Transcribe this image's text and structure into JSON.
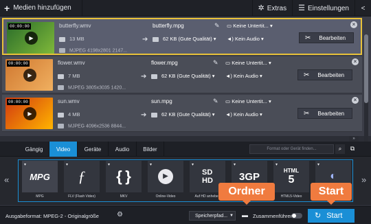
{
  "toolbar": {
    "add_media_label": "Medien hinzufügen",
    "extras_label": "Extras",
    "settings_label": "Einstellungen"
  },
  "files": [
    {
      "timecode": "00:00:00",
      "source_name": "butterfly.wmv",
      "source_size": "13 MB",
      "source_info": "MJPEG 4198x2801 2147...",
      "output_name": "butterfly.mpg",
      "output_size": "62 KB (Gute Qualität)",
      "subtitles": "Keine Untertit...",
      "audio": "Kein Audio",
      "edit_label": "Bearbeiten",
      "selected": true,
      "thumb_colors": [
        "#2a6d2a",
        "#7fb83a"
      ]
    },
    {
      "timecode": "00:00:00",
      "source_name": "flower.wmv",
      "source_size": "7 MB",
      "source_info": "MJPEG 3805x3035 1420...",
      "output_name": "flower.mpg",
      "output_size": "62 KB (Gute Qualität)",
      "subtitles": "Keine Untertit...",
      "audio": "Kein Audio",
      "edit_label": "Bearbeiten",
      "selected": false,
      "thumb_colors": [
        "#d07830",
        "#f0b060"
      ]
    },
    {
      "timecode": "00:00:00",
      "source_name": "sun.wmv",
      "source_size": "4 MB",
      "source_info": "MJPEG 4096x2536 8844...",
      "output_name": "sun.mpg",
      "output_size": "62 KB (Gute Qualität)",
      "subtitles": "Keine Untertit...",
      "audio": "Kein Audio",
      "edit_label": "Bearbeiten",
      "selected": false,
      "thumb_colors": [
        "#d23a10",
        "#ffb400"
      ]
    }
  ],
  "tabs": [
    {
      "label": "Gängig",
      "active": false
    },
    {
      "label": "Video",
      "active": true
    },
    {
      "label": "Geräte",
      "active": false
    },
    {
      "label": "Audio",
      "active": false
    },
    {
      "label": "Bilder",
      "active": false
    }
  ],
  "search": {
    "placeholder": "Format oder Gerät finden..."
  },
  "formats": [
    {
      "label": "MPG",
      "icon": "mpg-icon",
      "selected": true
    },
    {
      "label": "FLV (Flash Video)",
      "icon": "flash-icon",
      "selected": false
    },
    {
      "label": "MKV",
      "icon": "mkv-icon",
      "selected": false
    },
    {
      "label": "Online-Video",
      "icon": "online-video-icon",
      "selected": false
    },
    {
      "label": "Auf HD anheben",
      "icon": "sd-hd-icon",
      "selected": false
    },
    {
      "label": "3GP",
      "icon": "3gp-icon",
      "selected": false
    },
    {
      "label": "HTML5-Video",
      "icon": "html5-icon",
      "selected": false
    },
    {
      "label": "",
      "icon": "bluray-icon",
      "selected": false
    }
  ],
  "bottom": {
    "output_format": "Ausgabeformat: MPEG-2  - Originalgröße",
    "save_path_label": "Speicherpfad...",
    "merge_label": "Zusammenführen",
    "start_label": "Start"
  },
  "callouts": {
    "folder": "Ordner",
    "start": "Start"
  },
  "colors": {
    "accent": "#1a8fd6",
    "callout": "#f07b3f",
    "selection": "#e9c23a"
  }
}
